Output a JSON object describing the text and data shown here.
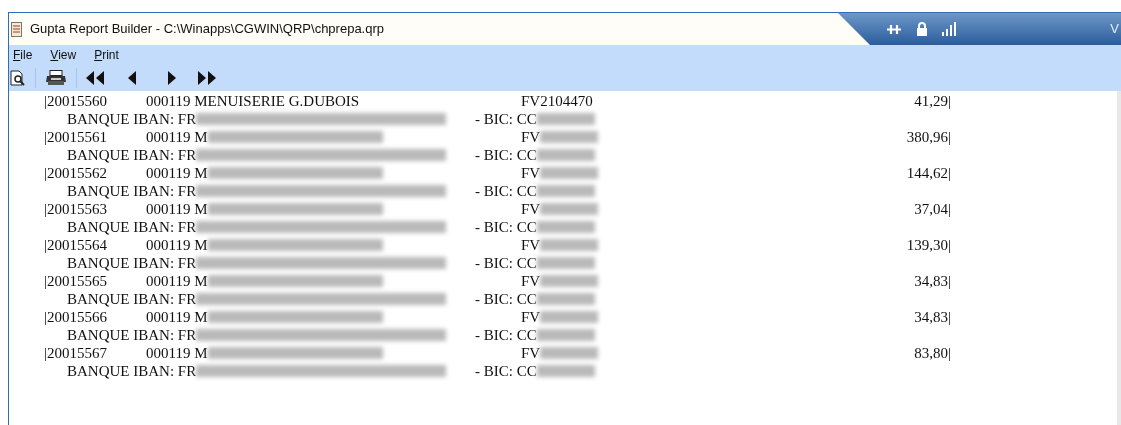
{
  "window": {
    "title": "Gupta Report Builder - C:\\Winapps\\CGWIN\\QRP\\chprepa.qrp"
  },
  "tray": {
    "text": "V"
  },
  "menu": [
    {
      "label": "File"
    },
    {
      "label": "View"
    },
    {
      "label": "Print"
    }
  ],
  "report": {
    "rows": [
      {
        "kind": "entry",
        "number": "|20015560",
        "name": "000119 MENUISERIE G.DUBOIS",
        "invoice": "FV2104470",
        "amount": "41,29|"
      },
      {
        "kind": "bank",
        "label": "BANQUE IBAN: FR",
        "bic": "- BIC: CC"
      },
      {
        "kind": "entry",
        "number": "|20015561",
        "name": "000119 M",
        "invoice": "FV",
        "amount": "380,96|"
      },
      {
        "kind": "bank",
        "label": "BANQUE IBAN: FR",
        "bic": "- BIC: CC"
      },
      {
        "kind": "entry",
        "number": "|20015562",
        "name": "000119 M",
        "invoice": "FV",
        "amount": "144,62|"
      },
      {
        "kind": "bank",
        "label": "BANQUE IBAN: FR",
        "bic": "- BIC: CC"
      },
      {
        "kind": "entry",
        "number": "|20015563",
        "name": "000119 M",
        "invoice": "FV",
        "amount": "37,04|"
      },
      {
        "kind": "bank",
        "label": "BANQUE IBAN: FR",
        "bic": "- BIC: CC"
      },
      {
        "kind": "entry",
        "number": "|20015564",
        "name": "000119 M",
        "invoice": "FV",
        "amount": "139,30|"
      },
      {
        "kind": "bank",
        "label": "BANQUE IBAN: FR",
        "bic": "- BIC: CC"
      },
      {
        "kind": "entry",
        "number": "|20015565",
        "name": "000119 M",
        "invoice": "FV",
        "amount": "34,83|"
      },
      {
        "kind": "bank",
        "label": "BANQUE IBAN: FR",
        "bic": "- BIC: CC"
      },
      {
        "kind": "entry",
        "number": "|20015566",
        "name": "000119 M",
        "invoice": "FV",
        "amount": "34,83|"
      },
      {
        "kind": "bank",
        "label": "BANQUE IBAN: FR",
        "bic": "- BIC: CC"
      },
      {
        "kind": "entry",
        "number": "|20015567",
        "name": "000119 M",
        "invoice": "FV",
        "amount": "83,80|"
      },
      {
        "kind": "bank",
        "label": "BANQUE IBAN: FR",
        "bic": "- BIC: CC"
      }
    ]
  }
}
